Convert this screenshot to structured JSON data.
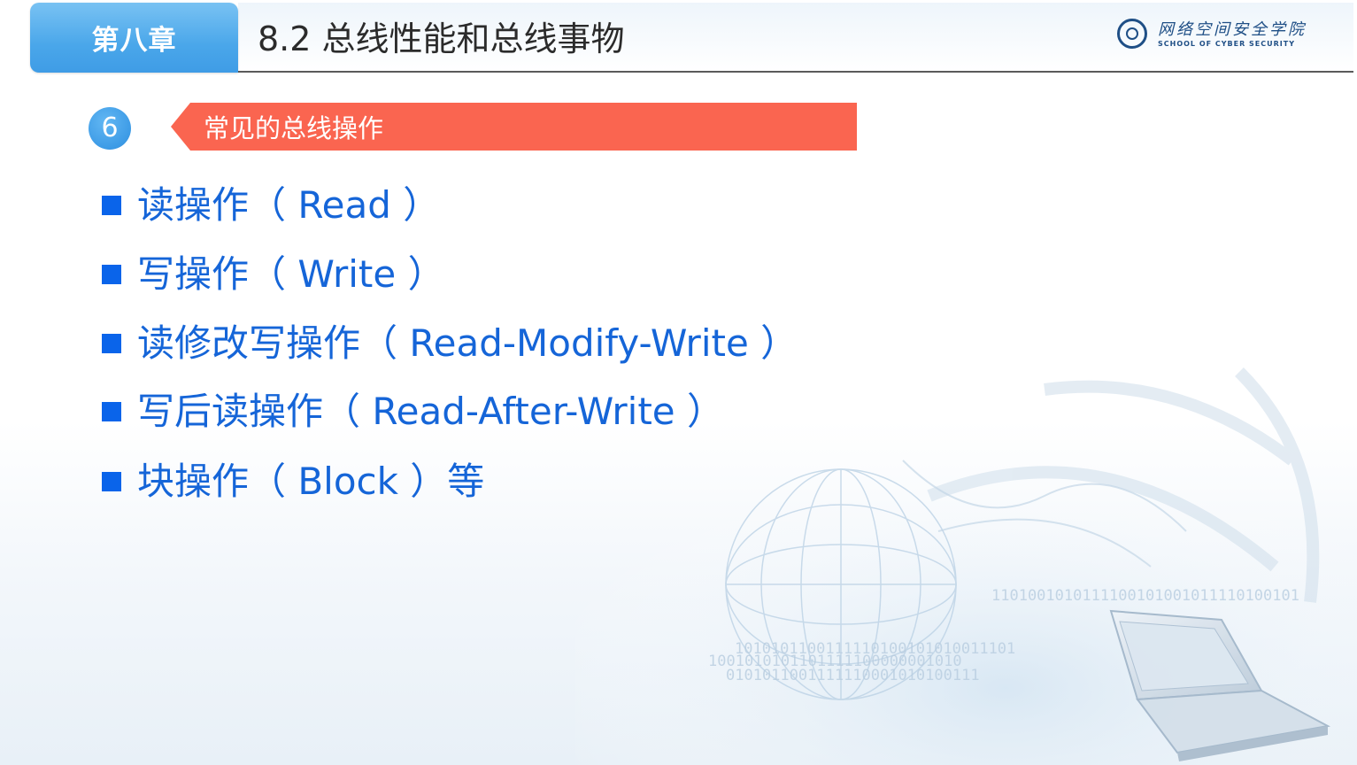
{
  "header": {
    "chapter_label": "第八章",
    "title": "8.2 总线性能和总线事物",
    "logo_cn": "网络空间安全学院",
    "logo_en": "SCHOOL OF CYBER SECURITY"
  },
  "section": {
    "number": "6",
    "title": "常见的总线操作"
  },
  "bullets": [
    {
      "text": "读操作（ Read ）"
    },
    {
      "text": "写操作（ Write ）"
    },
    {
      "text": "读修改写操作（ Read-Modify-Write ）"
    },
    {
      "text": "写后读操作（ Read-After-Write ）"
    },
    {
      "text": "块操作（ Block ）等"
    }
  ],
  "colors": {
    "chapter_tab": "#4aa7ea",
    "section_banner": "#fa6550",
    "bullet_text": "#1565d8",
    "bullet_square": "#0a64ea"
  },
  "decoration": {
    "binary_text": "1101001010111100101001011110100101"
  }
}
